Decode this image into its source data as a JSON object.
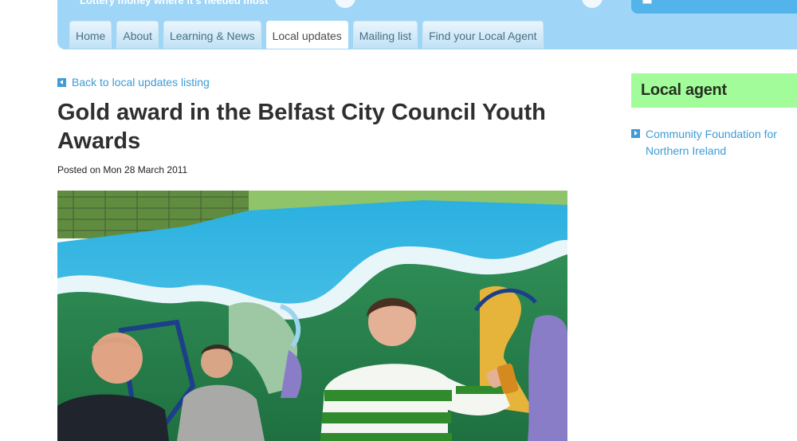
{
  "header": {
    "tagline": "Lottery money where it's needed most"
  },
  "nav": {
    "tabs": [
      {
        "label": "Home",
        "active": false
      },
      {
        "label": "About",
        "active": false
      },
      {
        "label": "Learning & News",
        "active": false
      },
      {
        "label": "Local updates",
        "active": true
      },
      {
        "label": "Mailing list",
        "active": false
      },
      {
        "label": "Find your Local Agent",
        "active": false
      }
    ]
  },
  "main": {
    "back_link": "Back to local updates listing",
    "title": "Gold award in the Belfast City Council Youth Awards",
    "posted": "Posted on Mon 28 March 2011"
  },
  "sidebar": {
    "agent_heading": "Local agent",
    "agent_link": "Community Foundation for Northern Ireland"
  },
  "colors": {
    "header": "#9fd5f6",
    "link": "#3d9bd6",
    "agent_box": "#a3fc9a"
  }
}
